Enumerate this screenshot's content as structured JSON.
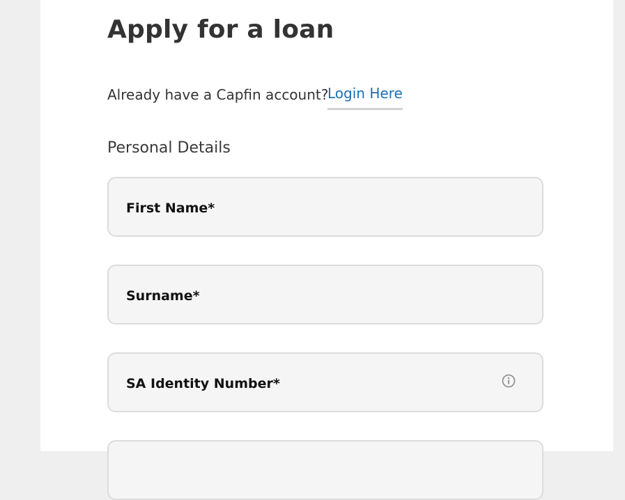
{
  "page": {
    "title": "Apply for a loan",
    "account_prompt": "Already have a Capfin account?",
    "login_link": "Login Here",
    "section_title": "Personal Details"
  },
  "fields": [
    {
      "label": "First Name*",
      "value": ""
    },
    {
      "label": "Surname*",
      "value": ""
    },
    {
      "label": "SA Identity Number*",
      "value": "",
      "icon": "info-icon"
    },
    {
      "label": "",
      "value": ""
    }
  ],
  "colors": {
    "page_background": "#efeff0",
    "card_background": "#ffffff",
    "link": "#1a6fb5",
    "field_background": "#f5f5f5",
    "field_border": "#dcdcdc"
  }
}
